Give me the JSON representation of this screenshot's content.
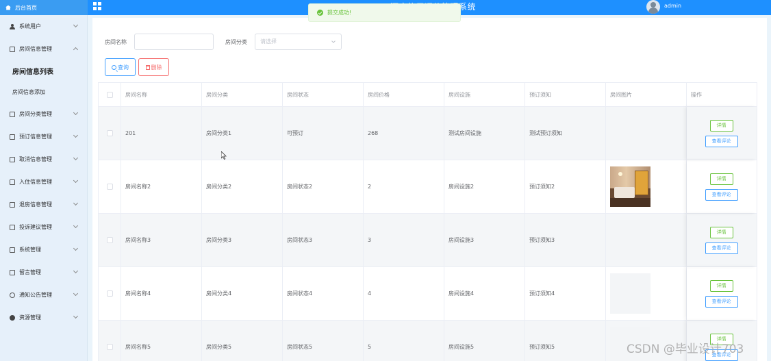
{
  "header": {
    "home_label": "后台首页",
    "system_title": "酒店信用评价管理系统",
    "username": "admin"
  },
  "toast": {
    "message": "提交成功!"
  },
  "sidebar": {
    "items": [
      {
        "label": "系统用户",
        "icon": "person-icon"
      },
      {
        "label": "房间信息管理",
        "icon": "edit-icon",
        "expanded": true,
        "children": [
          {
            "label": "房间信息列表",
            "active": true
          },
          {
            "label": "房间信息添加"
          }
        ]
      },
      {
        "label": "房间分类管理",
        "icon": "edit-icon"
      },
      {
        "label": "预订信息管理",
        "icon": "edit-icon"
      },
      {
        "label": "取消信息管理",
        "icon": "edit-icon"
      },
      {
        "label": "入住信息管理",
        "icon": "edit-icon"
      },
      {
        "label": "退房信息管理",
        "icon": "edit-icon"
      },
      {
        "label": "投诉建议管理",
        "icon": "edit-icon"
      },
      {
        "label": "系统管理",
        "icon": "picture-icon"
      },
      {
        "label": "留言管理",
        "icon": "picture-icon"
      },
      {
        "label": "通知公告管理",
        "icon": "info-icon"
      },
      {
        "label": "资源管理",
        "icon": "dot-icon"
      }
    ]
  },
  "search": {
    "name_label": "房间名称",
    "name_value": "",
    "category_label": "房间分类",
    "category_placeholder": "请选择",
    "query_button": "查询",
    "delete_button": "删除"
  },
  "table": {
    "columns": [
      "房间名称",
      "房间分类",
      "房间状态",
      "房间价格",
      "房间设施",
      "预订须知",
      "房间图片",
      "操作"
    ],
    "rows": [
      {
        "name": "201",
        "category": "房间分类1",
        "status": "可预订",
        "price": "268",
        "facility": "测试房间设施",
        "notice": "测试预订须知",
        "image": "none"
      },
      {
        "name": "房间名称2",
        "category": "房间分类2",
        "status": "房间状态2",
        "price": "2",
        "facility": "房间设施2",
        "notice": "预订须知2",
        "image": "room-photo"
      },
      {
        "name": "房间名称3",
        "category": "房间分类3",
        "status": "房间状态3",
        "price": "3",
        "facility": "房间设施3",
        "notice": "预订须知3",
        "image": "placeholder"
      },
      {
        "name": "房间名称4",
        "category": "房间分类4",
        "status": "房间状态4",
        "price": "4",
        "facility": "房间设施4",
        "notice": "预订须知4",
        "image": "placeholder"
      },
      {
        "name": "房间名称5",
        "category": "房间分类5",
        "status": "房间状态5",
        "price": "5",
        "facility": "房间设施5",
        "notice": "预订须知5",
        "image": "placeholder"
      }
    ],
    "detail_button": "详情",
    "review_button": "查看评论"
  },
  "watermark": "CSDN @毕业设计703",
  "colors": {
    "header_blue": "#1e90ff",
    "primary": "#409eff",
    "success": "#67c23a",
    "danger": "#f56c6c",
    "sidebar_bg": "#e6f0fa"
  }
}
